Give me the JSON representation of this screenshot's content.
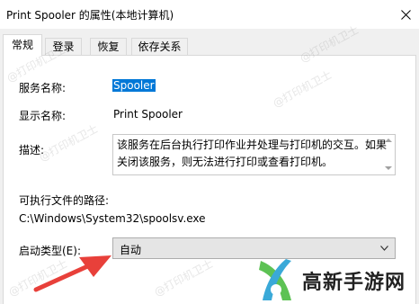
{
  "window": {
    "title": "Print Spooler 的属性(本地计算机)"
  },
  "tabs": [
    {
      "label": "常规",
      "active": true
    },
    {
      "label": "登录",
      "active": false
    },
    {
      "label": "恢复",
      "active": false
    },
    {
      "label": "依存关系",
      "active": false
    }
  ],
  "general": {
    "service_name_label": "服务名称:",
    "service_name_value": "Spooler",
    "display_name_label": "显示名称:",
    "display_name_value": "Print Spooler",
    "description_label": "描述:",
    "description_value": "该服务在后台执行打印作业并处理与打印机的交互。如果关闭该服务，则无法进行打印或查看打印机。",
    "exe_path_label": "可执行文件的路径:",
    "exe_path_value": "C:\\Windows\\System32\\spoolsv.exe",
    "startup_type_label": "启动类型(E):",
    "startup_type_value": "自动"
  },
  "overlay": {
    "brand_name": "高新手游网",
    "watermark_text": "@打印机卫士"
  },
  "colors": {
    "selection": "#0078d7",
    "annotation_arrow": "#e8403a",
    "brand_green": "#5dc254"
  }
}
